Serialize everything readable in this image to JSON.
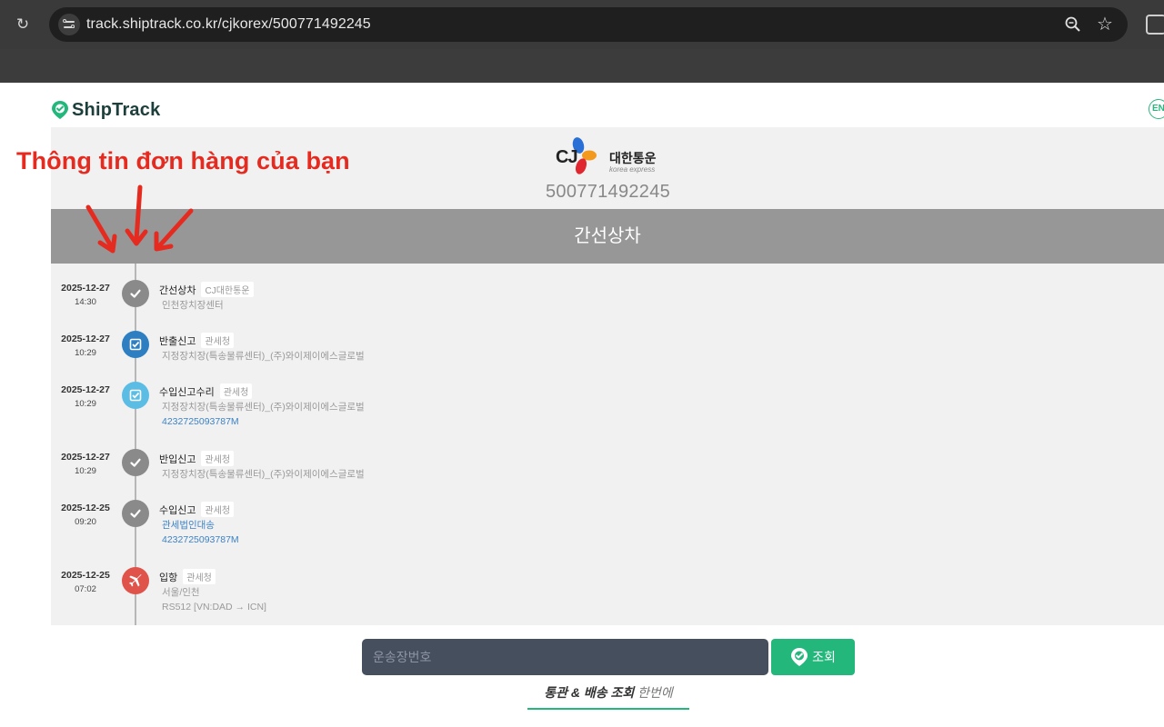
{
  "browser": {
    "url": "track.shiptrack.co.kr/cjkorex/500771492245"
  },
  "header": {
    "logo_text": "ShipTrack",
    "lang_label": "EN"
  },
  "carrier": {
    "mark": "CJ",
    "name": "대한통운",
    "subtitle": "korea express",
    "tracking_number": "500771492245",
    "status": "간선상차"
  },
  "events": [
    {
      "date": "2025-12-27",
      "time": "14:30",
      "title": "간선상차",
      "source": "CJ대한통운",
      "icon": "check-icon",
      "color": "#8a8a8a",
      "lines": [
        "인천장치장센터"
      ],
      "links": []
    },
    {
      "date": "2025-12-27",
      "time": "10:29",
      "title": "반출신고",
      "source": "관세청",
      "icon": "checkbox-icon",
      "color": "#2e7fc1",
      "lines": [
        "지정장치장(특송물류센터)_(주)와이제이에스글로벌"
      ],
      "links": []
    },
    {
      "date": "2025-12-27",
      "time": "10:29",
      "title": "수입신고수리",
      "source": "관세청",
      "icon": "checkbox-icon",
      "color": "#5bbde4",
      "lines": [
        "지정장치장(특송물류센터)_(주)와이제이에스글로벌"
      ],
      "links": [
        "4232725093787M"
      ]
    },
    {
      "date": "2025-12-27",
      "time": "10:29",
      "title": "반입신고",
      "source": "관세청",
      "icon": "check-icon",
      "color": "#8a8a8a",
      "lines": [
        "지정장치장(특송물류센터)_(주)와이제이에스글로벌"
      ],
      "links": []
    },
    {
      "date": "2025-12-25",
      "time": "09:20",
      "title": "수입신고",
      "source": "관세청",
      "icon": "check-icon",
      "color": "#8a8a8a",
      "lines": [],
      "links": [
        "관세법인대송",
        "4232725093787M"
      ]
    },
    {
      "date": "2025-12-25",
      "time": "07:02",
      "title": "입항",
      "source": "관세청",
      "icon": "plane-icon",
      "color": "#e0534a",
      "lines": [
        "서울/인천",
        "RS512 [VN:DAD → ICN]"
      ],
      "links": []
    }
  ],
  "search": {
    "placeholder": "운송장번호",
    "button_label": "조회"
  },
  "tagline": {
    "strong": "통관 & 배송 조회",
    "light": "한번에"
  },
  "annotation": {
    "text": "Thông tin đơn hàng của bạn",
    "color": "#e52b20"
  }
}
